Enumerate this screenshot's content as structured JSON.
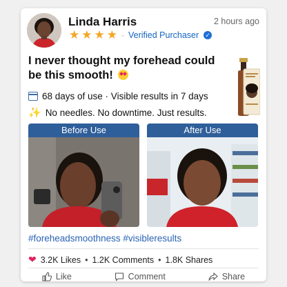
{
  "post": {
    "author": "Linda Harris",
    "time": "2 hours ago",
    "rating": 4,
    "verified": "Verified Purchaser",
    "headline": "I never thought my forehead could be this smooth!",
    "detail1": "68 days of use · Visible results in 7 days",
    "detail2": "No needles. No downtime. Just results.",
    "before_label": "Before Use",
    "after_label": "After Use",
    "hashtags": "#foreheadsmoothness #visibleresults"
  },
  "stats": {
    "likes": "3.2K Likes",
    "comments": "1.2K Comments",
    "shares": "1.8K Shares"
  },
  "actions": {
    "like": "Like",
    "comment": "Comment",
    "share": "Share"
  },
  "colors": {
    "accent": "#2f5f9a",
    "star": "#f5a623",
    "heart": "#e0245e",
    "hashtag": "#2a63b5"
  },
  "icons": {
    "calendar": "calendar-icon",
    "sparkle": "sparkle-icon",
    "heart": "heart-icon",
    "verified": "verified-check-icon"
  }
}
